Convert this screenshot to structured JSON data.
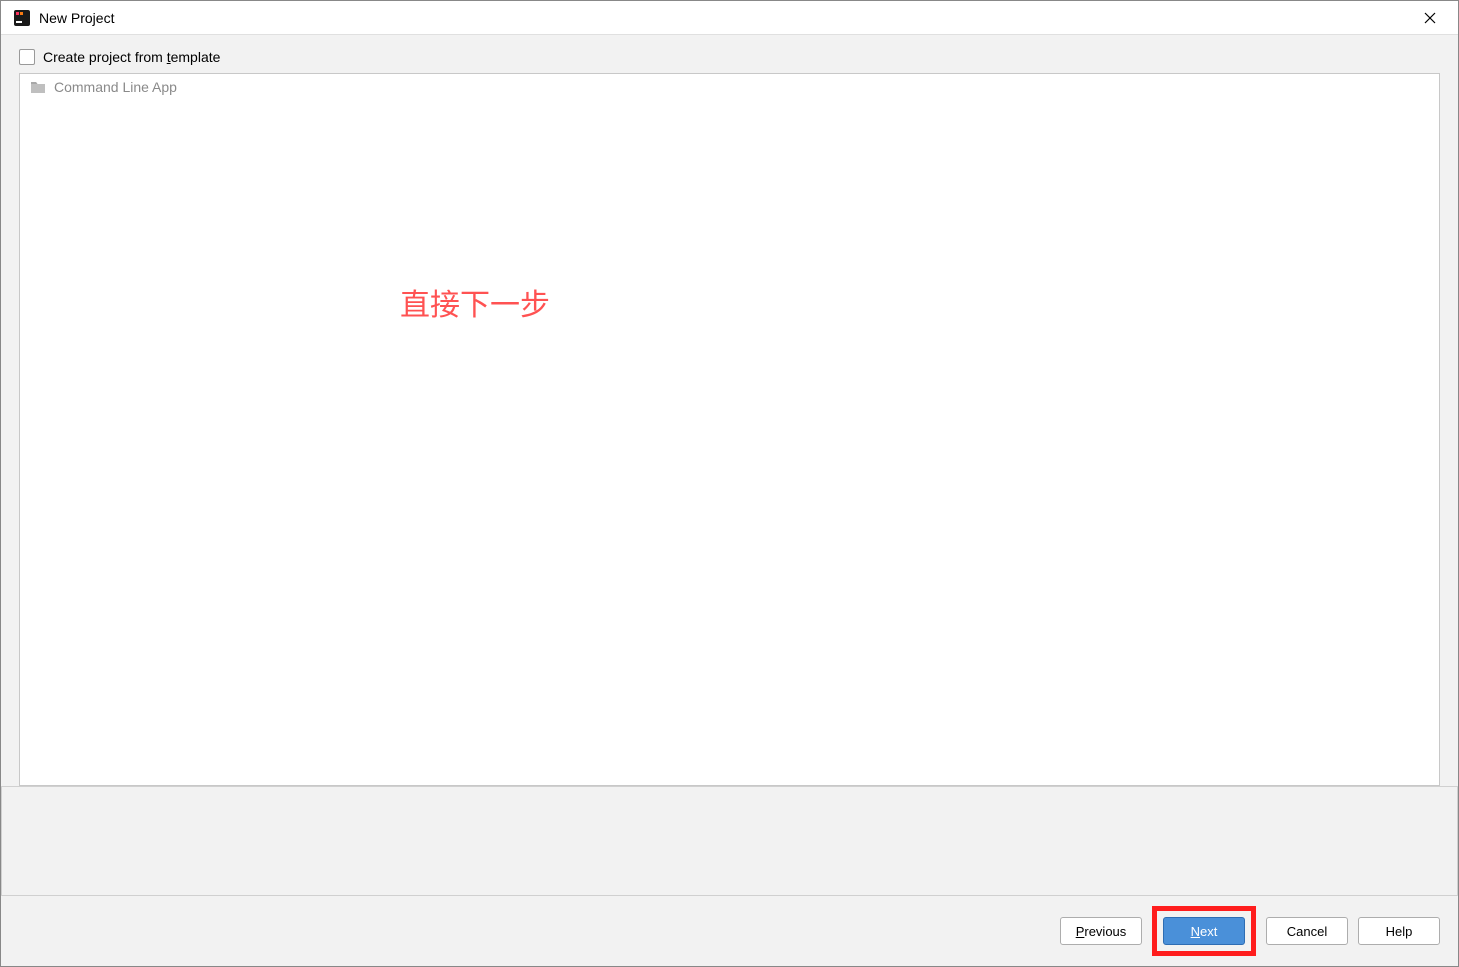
{
  "window": {
    "title": "New Project"
  },
  "checkbox": {
    "label_pre": "Create project from ",
    "label_underline": "t",
    "label_post": "emplate"
  },
  "template_item": {
    "label": "Command Line App"
  },
  "annotation": {
    "text": "直接下一步"
  },
  "buttons": {
    "previous_pre": "",
    "previous_underline": "P",
    "previous_post": "revious",
    "next_pre": "",
    "next_underline": "N",
    "next_post": "ext",
    "cancel": "Cancel",
    "help": "Help"
  }
}
